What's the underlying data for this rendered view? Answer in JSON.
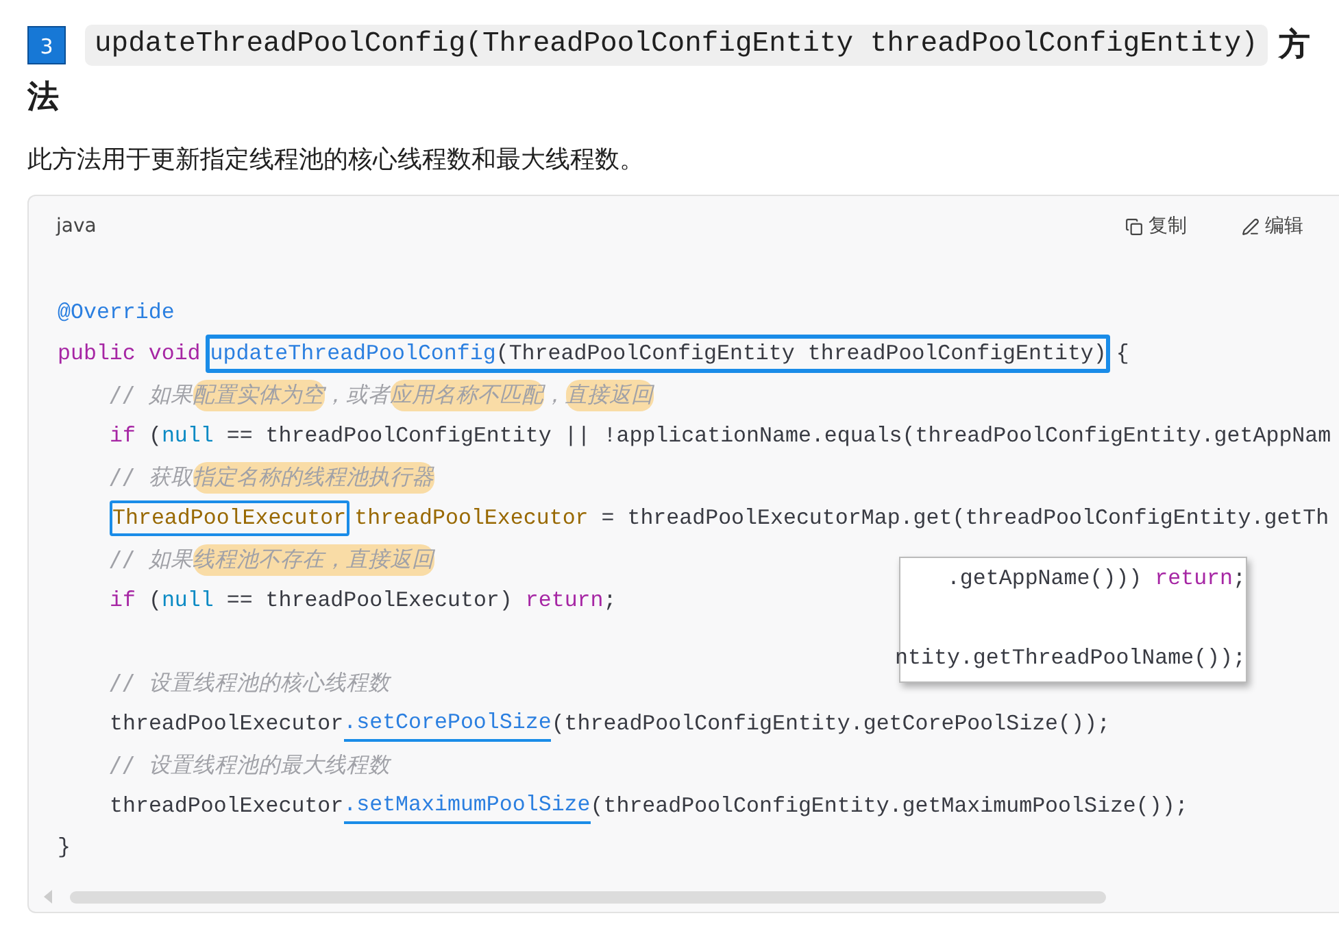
{
  "heading": {
    "number": "3",
    "code": "updateThreadPoolConfig(ThreadPoolConfigEntity threadPoolConfigEntity)",
    "text": "方",
    "text_continued": "法"
  },
  "intro": "此方法用于更新指定线程池的核心线程数和最大线程数。",
  "code_block": {
    "language": "java",
    "actions": [
      {
        "kind": "copy",
        "label": "复制"
      },
      {
        "kind": "edit",
        "label": "编辑"
      }
    ],
    "lines": [
      {
        "kind": "top",
        "segments": [
          {
            "kind": "plain",
            "tokens": [
              {
                "t": "@Override",
                "kind": "fn"
              }
            ]
          }
        ]
      },
      {
        "kind": "top",
        "segments": [
          {
            "kind": "plain",
            "tokens": [
              {
                "t": "public void",
                "kind": "kw"
              }
            ]
          },
          {
            "kind": "boxed",
            "tokens": [
              {
                "t": "updateThreadPoolConfig",
                "kind": "fn"
              },
              {
                "t": "(ThreadPoolConfigEntity threadPoolConfigEntity)",
                "kind": "plain"
              }
            ]
          },
          {
            "kind": "plain",
            "tokens": [
              {
                "t": "{",
                "kind": "plain"
              }
            ]
          }
        ]
      },
      {
        "kind": "body",
        "segments": [
          {
            "kind": "plain",
            "tokens": [
              {
                "t": "// 如果",
                "kind": "comment"
              }
            ]
          },
          {
            "kind": "highlighted",
            "tokens": [
              {
                "t": "配置实体为空",
                "kind": "comment"
              }
            ]
          },
          {
            "kind": "plain",
            "tokens": [
              {
                "t": "，或者",
                "kind": "comment"
              }
            ]
          },
          {
            "kind": "highlighted",
            "tokens": [
              {
                "t": "应用名称不匹配",
                "kind": "comment"
              }
            ]
          },
          {
            "kind": "plain",
            "tokens": [
              {
                "t": "，",
                "kind": "comment"
              }
            ]
          },
          {
            "kind": "highlighted",
            "tokens": [
              {
                "t": "直接返回",
                "kind": "comment"
              }
            ]
          }
        ]
      },
      {
        "kind": "body",
        "segments": [
          {
            "kind": "plain",
            "tokens": [
              {
                "t": "if",
                "kind": "kw"
              },
              {
                "t": " (",
                "kind": "plain"
              },
              {
                "t": "null",
                "kind": "lit"
              },
              {
                "t": " == threadPoolConfigEntity || !applicationName.equals(threadPoolConfigEntity.getAppNam",
                "kind": "plain"
              }
            ]
          }
        ]
      },
      {
        "kind": "body",
        "segments": [
          {
            "kind": "plain",
            "tokens": [
              {
                "t": "// 获取",
                "kind": "comment"
              }
            ]
          },
          {
            "kind": "highlighted",
            "tokens": [
              {
                "t": "指定名称的线程池执行器",
                "kind": "comment"
              }
            ]
          }
        ]
      },
      {
        "kind": "body",
        "segments": [
          {
            "kind": "thin-boxed",
            "tokens": [
              {
                "t": "ThreadPoolExecutor",
                "kind": "type"
              }
            ]
          },
          {
            "kind": "plain",
            "tokens": [
              {
                "t": "threadPoolExecutor",
                "kind": "type"
              },
              {
                "t": " = threadPoolExecutorMap.get(threadPoolConfigEntity.getTh",
                "kind": "plain"
              }
            ]
          }
        ]
      },
      {
        "kind": "body",
        "segments": [
          {
            "kind": "plain",
            "tokens": [
              {
                "t": "// 如果",
                "kind": "comment"
              }
            ]
          },
          {
            "kind": "highlighted",
            "tokens": [
              {
                "t": "线程池不存在，直接返回",
                "kind": "comment"
              }
            ]
          }
        ]
      },
      {
        "kind": "body",
        "segments": [
          {
            "kind": "plain",
            "tokens": [
              {
                "t": "if",
                "kind": "kw"
              },
              {
                "t": " (",
                "kind": "plain"
              },
              {
                "t": "null",
                "kind": "lit"
              },
              {
                "t": " == threadPoolExecutor) ",
                "kind": "plain"
              },
              {
                "t": "return",
                "kind": "kw"
              },
              {
                "t": ";",
                "kind": "plain"
              }
            ]
          }
        ]
      },
      {
        "kind": "body-spaced",
        "segments": [
          {
            "kind": "plain",
            "tokens": [
              {
                "t": "// 设置线程池的核心线程数",
                "kind": "comment"
              }
            ]
          }
        ]
      },
      {
        "kind": "body",
        "segments": [
          {
            "kind": "plain",
            "tokens": [
              {
                "t": "threadPoolExecutor",
                "kind": "plain"
              }
            ]
          },
          {
            "kind": "underlined",
            "tokens": [
              {
                "t": ".setCorePoolSize",
                "kind": "fn"
              }
            ]
          },
          {
            "kind": "plain",
            "tokens": [
              {
                "t": "(threadPoolConfigEntity.getCorePoolSize());",
                "kind": "plain"
              }
            ]
          }
        ]
      },
      {
        "kind": "body",
        "segments": [
          {
            "kind": "plain",
            "tokens": [
              {
                "t": "// 设置线程池的最大线程数",
                "kind": "comment"
              }
            ]
          }
        ]
      },
      {
        "kind": "body",
        "segments": [
          {
            "kind": "plain",
            "tokens": [
              {
                "t": "threadPoolExecutor",
                "kind": "plain"
              }
            ]
          },
          {
            "kind": "underlined",
            "tokens": [
              {
                "t": ".setMaximumPoolSize",
                "kind": "fn"
              }
            ]
          },
          {
            "kind": "plain",
            "tokens": [
              {
                "t": "(threadPoolConfigEntity.getMaximumPoolSize());",
                "kind": "plain"
              }
            ]
          }
        ]
      },
      {
        "kind": "top",
        "segments": [
          {
            "kind": "plain",
            "tokens": [
              {
                "t": "}",
                "kind": "plain"
              }
            ]
          }
        ]
      }
    ],
    "popup": [
      {
        "kind": "plain",
        "tokens": [
          {
            "t": ".getAppName())) ",
            "kind": "plain"
          },
          {
            "t": "return",
            "kind": "kw"
          },
          {
            "t": ";",
            "kind": "plain"
          }
        ]
      },
      {
        "kind": "plain",
        "tokens": [
          {
            "t": "ntity.getThreadPoolName());",
            "kind": "plain"
          }
        ]
      }
    ]
  }
}
